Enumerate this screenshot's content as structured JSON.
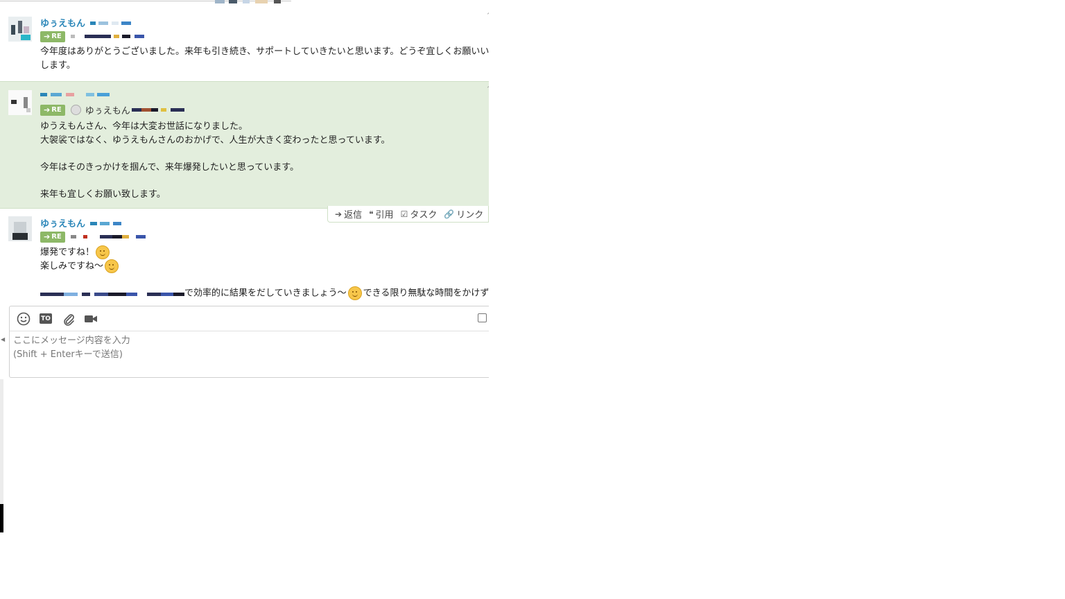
{
  "messages": [
    {
      "name": "ゆぅえもん",
      "re_label": "RE",
      "body": "今年度はありがとうございました。来年も引き続き、サポートしていきたいと思います。どうぞ宜しくお願いい\nします。"
    },
    {
      "re_label": "RE",
      "re_to_name": "ゆぅえもん",
      "body": "ゆうえもんさん、今年は大変お世話になりました。\n大袈裟ではなく、ゆうえもんさんのおかげで、人生が大きく変わったと思っています。\n\n今年はそのきっかけを掴んで、来年爆発したいと思っています。\n\n来年も宜しくお願い致します。"
    },
    {
      "name": "ゆぅえもん",
      "re_label": "RE",
      "line1": "爆発ですね！",
      "line2": "楽しみですね～",
      "line3_a": "で効率的に結果をだしていきましょう～",
      "line3_b": "できる限り無駄な時間をかけず"
    }
  ],
  "actions": {
    "reply": "返信",
    "quote": "引用",
    "task": "タスク",
    "link": "リンク"
  },
  "composer": {
    "to_label": "TO",
    "placeholder": "ここにメッセージ内容を入力\n(Shift + Enterキーで送信)"
  },
  "colors": {
    "highlight_bg": "#e3eedd",
    "name_blue": "#2a86b8",
    "re_green": "#8db867"
  },
  "icons": [
    "arrow-right-icon",
    "emoji-smile-icon",
    "to-icon",
    "paperclip-icon",
    "video-camera-icon",
    "reply-icon",
    "quote-icon",
    "task-check-icon",
    "link-icon",
    "checkbox-icon"
  ]
}
